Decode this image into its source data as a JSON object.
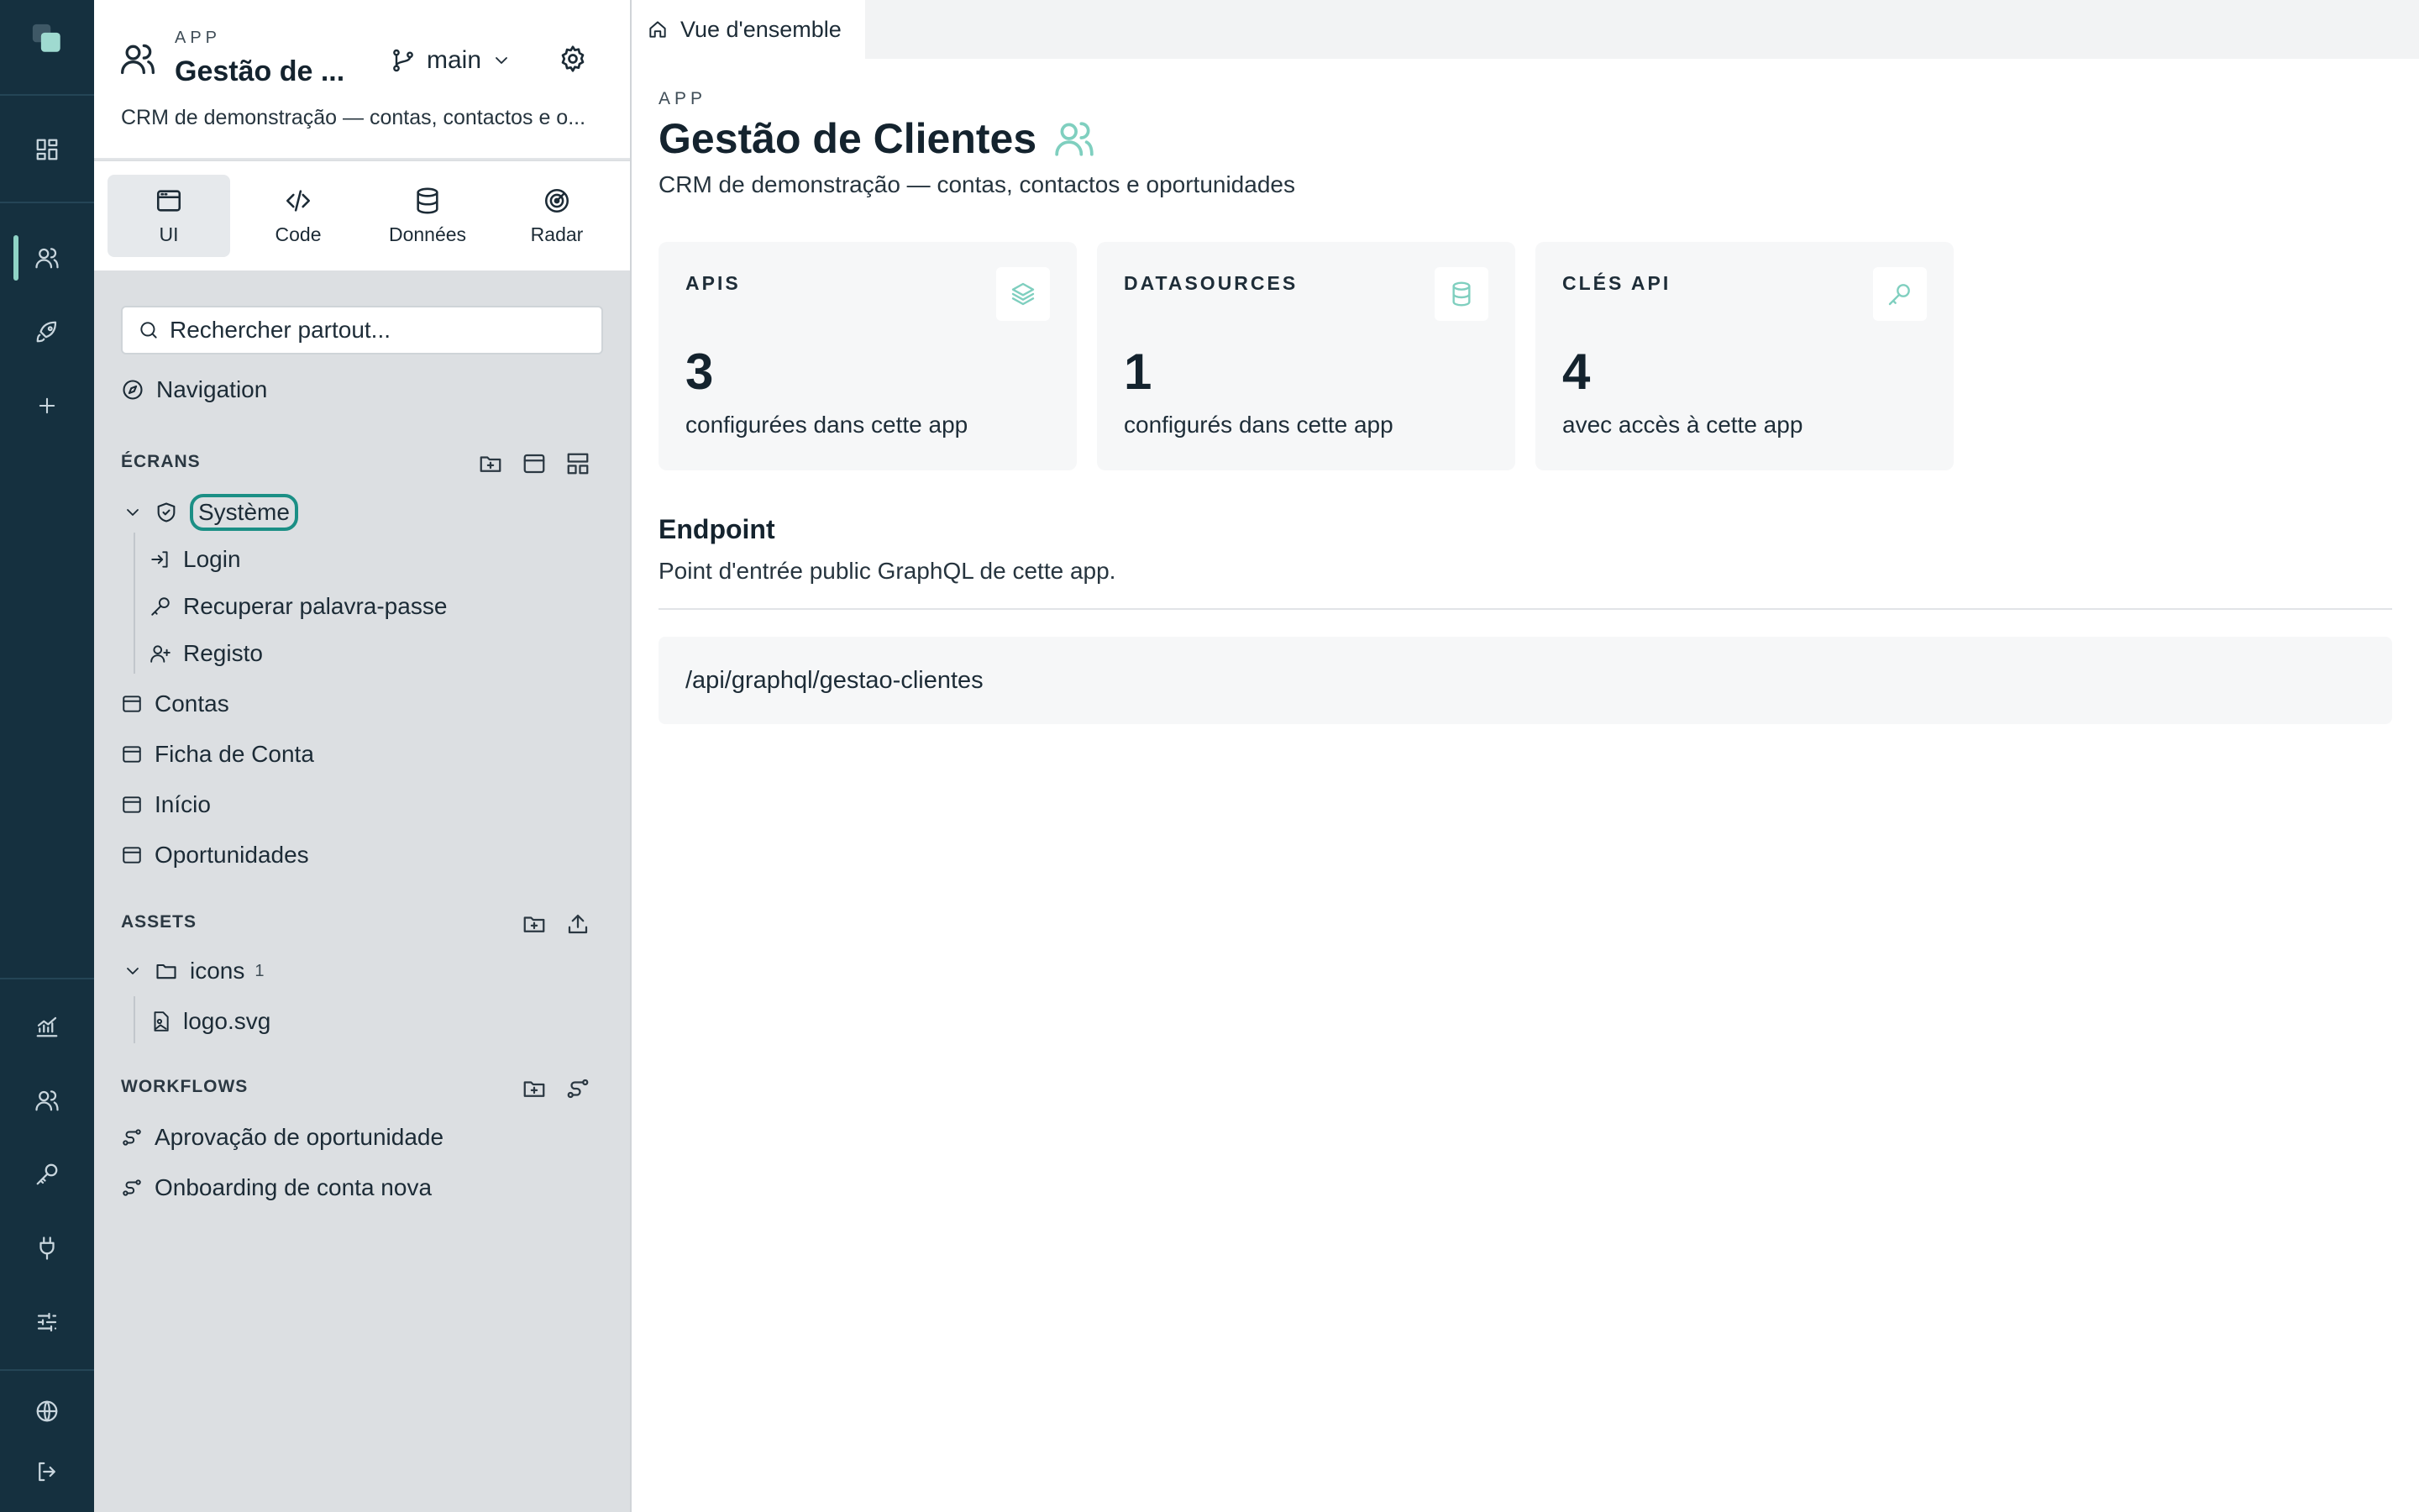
{
  "rail": {
    "icons": [
      "logo-icon",
      "dashboard-icon",
      "users-icon",
      "rocket-icon",
      "plus-icon",
      "analytics-icon",
      "team-icon",
      "key-icon",
      "plug-icon",
      "sliders-icon",
      "globe-icon",
      "logout-icon"
    ],
    "accent": "#8fd3c6",
    "background": "#15303f"
  },
  "sidebar": {
    "app_eyebrow": "APP",
    "app_name": "Gestão de ...",
    "branch": "main",
    "app_desc": "CRM de demonstração — contas, contactos e o...",
    "tabs": [
      {
        "label": "UI"
      },
      {
        "label": "Code"
      },
      {
        "label": "Données"
      },
      {
        "label": "Radar"
      }
    ],
    "search_placeholder": "Rechercher partout...",
    "navigation_label": "Navigation",
    "screens_title": "ÉCRANS",
    "system_label": "Système",
    "system_children": [
      "Login",
      "Recuperar palavra-passe",
      "Registo"
    ],
    "screens": [
      "Contas",
      "Ficha de Conta",
      "Início",
      "Oportunidades"
    ],
    "assets_title": "ASSETS",
    "assets_folder": "icons",
    "assets_folder_count": "1",
    "assets_file": "logo.svg",
    "workflows_title": "WORKFLOWS",
    "workflows": [
      "Aprovação de oportunidade",
      "Onboarding de conta nova"
    ]
  },
  "main": {
    "tab_label": "Vue d'ensemble",
    "eyebrow": "APP",
    "title": "Gestão de Clientes",
    "subtitle": "CRM de demonstração — contas, contactos e oportunidades",
    "cards": [
      {
        "title": "APIS",
        "value": "3",
        "desc": "configurées dans cette app",
        "icon": "layers-icon"
      },
      {
        "title": "DATASOURCES",
        "value": "1",
        "desc": "configurés dans cette app",
        "icon": "database-icon"
      },
      {
        "title": "CLÉS API",
        "value": "4",
        "desc": "avec accès à cette app",
        "icon": "key-icon"
      }
    ],
    "endpoint_title": "Endpoint",
    "endpoint_sub": "Point d'entrée public GraphQL de cette app.",
    "endpoint_url": "/api/graphql/gestao-clientes",
    "accent": "#7fcfbf"
  }
}
